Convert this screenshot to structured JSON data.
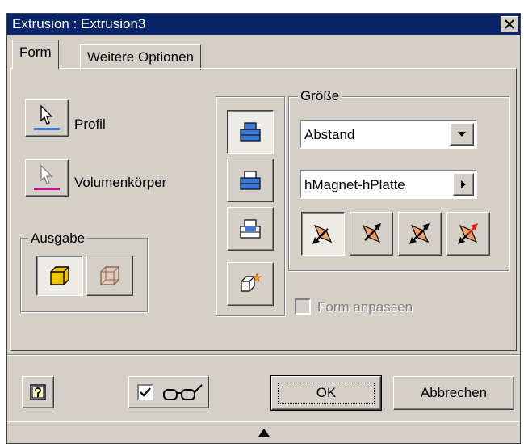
{
  "window": {
    "title": "Extrusion : Extrusion3"
  },
  "tabs": [
    {
      "label": "Form"
    },
    {
      "label": "Weitere Optionen"
    }
  ],
  "form": {
    "profil_label": "Profil",
    "volumenkoerper_label": "Volumenkörper",
    "ausgabe_label": "Ausgabe",
    "groesse_label": "Größe",
    "extent_type": "Abstand",
    "distance_value": "hMagnet-hPlatte",
    "form_anpassen_label": "Form anpassen",
    "form_anpassen_checked": false
  },
  "footer": {
    "ok_label": "OK",
    "cancel_label": "Abbrechen",
    "preview_checked": true
  },
  "colors": {
    "titlebar": "#0a246a",
    "face": "#d4d0c8",
    "profil_accent": "#3c78d8",
    "volumen_accent": "#c8148c",
    "extrude_face": "#f0a060",
    "solid_face": "#f2c400"
  }
}
